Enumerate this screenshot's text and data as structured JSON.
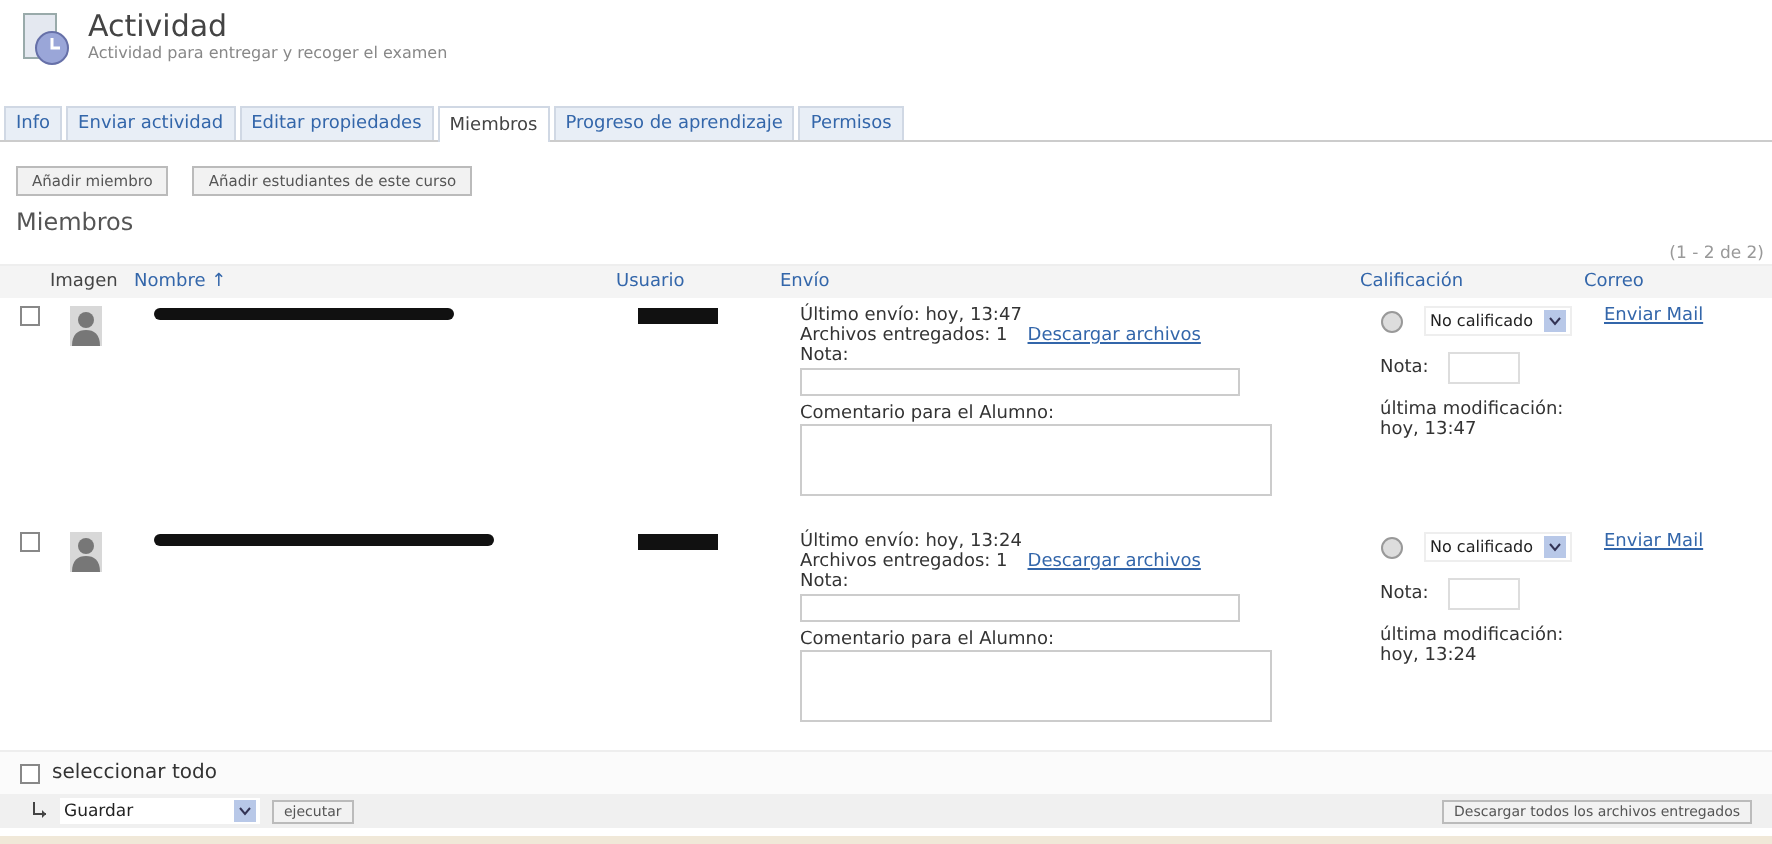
{
  "header": {
    "title": "Actividad",
    "subtitle": "Actividad para entregar y recoger el examen"
  },
  "tabs": [
    {
      "label": "Info",
      "selected": false
    },
    {
      "label": "Enviar actividad",
      "selected": false
    },
    {
      "label": "Editar propiedades",
      "selected": false
    },
    {
      "label": "Miembros",
      "selected": true
    },
    {
      "label": "Progreso de aprendizaje",
      "selected": false
    },
    {
      "label": "Permisos",
      "selected": false
    }
  ],
  "actions": [
    "Añadir miembro",
    "Añadir estudiantes de este curso"
  ],
  "section_title": "Miembros",
  "count": "(1 - 2 de 2)",
  "columns": [
    "Imagen",
    "Nombre ↑",
    "Usuario",
    "Envío",
    "Calificación",
    "Correo"
  ],
  "rows": [
    {
      "checked": false,
      "last_submission": "Último envío: hoy, 13:47",
      "files": "Archivos entregados: 1",
      "download": "Descargar archivos",
      "note_label": "Nota:",
      "comment_label": "Comentario para el Alumno:",
      "grade": "No calificado",
      "grade_note_label": "Nota:",
      "modified_label": "última modificación:",
      "modified": "hoy, 13:47",
      "mail": "Enviar Mail"
    },
    {
      "checked": false,
      "last_submission": "Último envío: hoy, 13:24",
      "files": "Archivos entregados: 1",
      "download": "Descargar archivos",
      "note_label": "Nota:",
      "comment_label": "Comentario para el Alumno:",
      "grade": "No calificado",
      "grade_note_label": "Nota:",
      "modified_label": "última modificación:",
      "modified": "hoy, 13:24",
      "mail": "Enviar Mail"
    }
  ],
  "select_all": {
    "label": "seleccionar todo",
    "checked": false
  },
  "bulk": {
    "action": "Guardar",
    "run": "ejecutar",
    "download_all": "Descargar todos los archivos entregados"
  }
}
